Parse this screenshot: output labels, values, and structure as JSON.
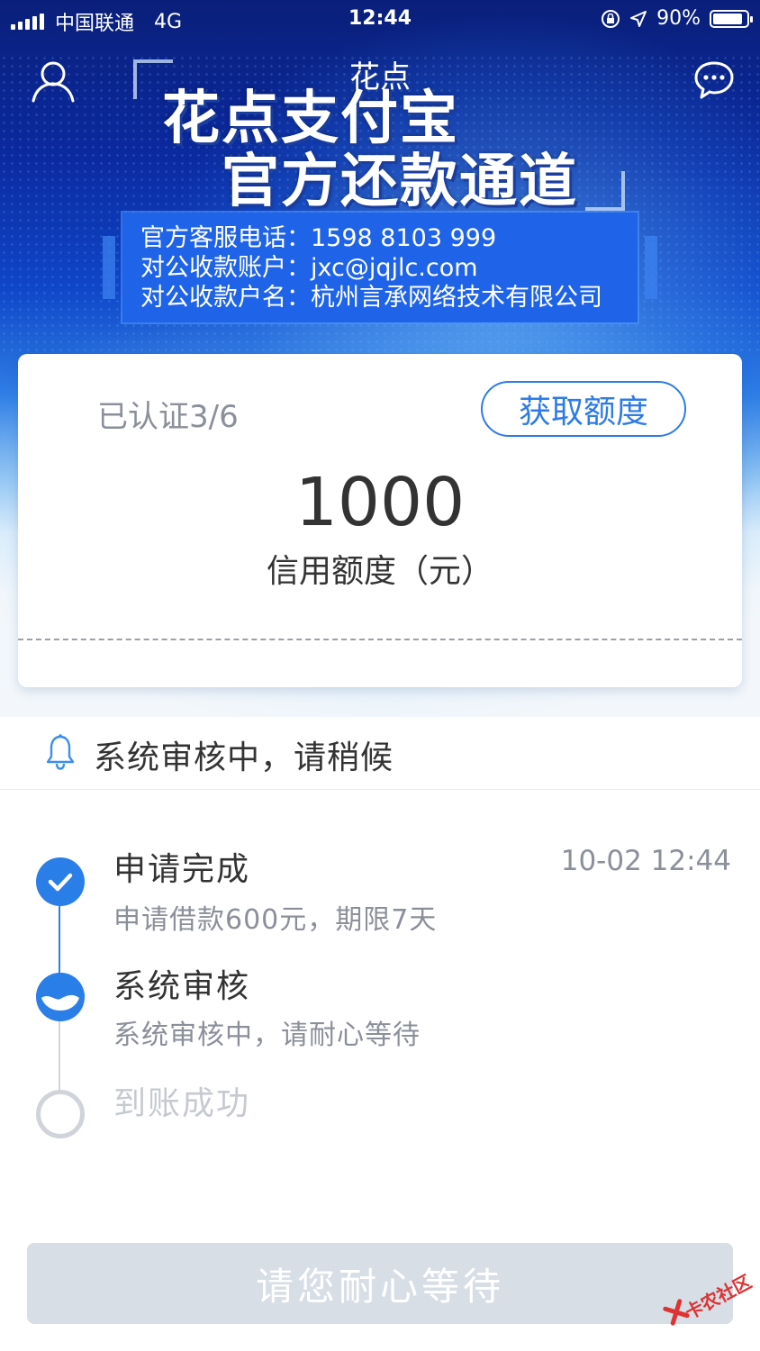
{
  "status_bar": {
    "carrier": "中国联通",
    "network": "4G",
    "time": "12:44",
    "battery": "90%",
    "battery_level": 0.9
  },
  "header": {
    "title": "花点",
    "profile_icon": "person-icon",
    "message_icon": "chat-bubble-icon"
  },
  "banner": {
    "line1": "花点支付宝",
    "line2": "官方还款通道",
    "info": [
      "官方客服电话：1598 8103 999",
      "对公收款账户：jxc@jqjlc.com",
      "对公收款户名：杭州言承网络技术有限公司"
    ]
  },
  "card": {
    "verified": "已认证3/6",
    "quota_button": "获取额度",
    "amount": "1000",
    "amount_label": "信用额度（元）"
  },
  "notice": {
    "icon": "bell-icon",
    "text": "系统审核中，请稍候"
  },
  "steps": [
    {
      "title": "申请完成",
      "sub": "申请借款600元，期限7天",
      "time": "10-02 12:44",
      "state": "done"
    },
    {
      "title": "系统审核",
      "sub": "系统审核中，请耐心等待",
      "time": "",
      "state": "in-progress"
    },
    {
      "title": "到账成功",
      "sub": "",
      "time": "",
      "state": "pending"
    }
  ],
  "colors": {
    "accent": "#2d7be6",
    "step_done": "#2a7ee8",
    "step_pending": "#d0d4da",
    "button_disabled": "#d8dee6",
    "watermark": "#d33333"
  },
  "bottom_button": "请您耐心等待",
  "watermark": "卡农社区"
}
